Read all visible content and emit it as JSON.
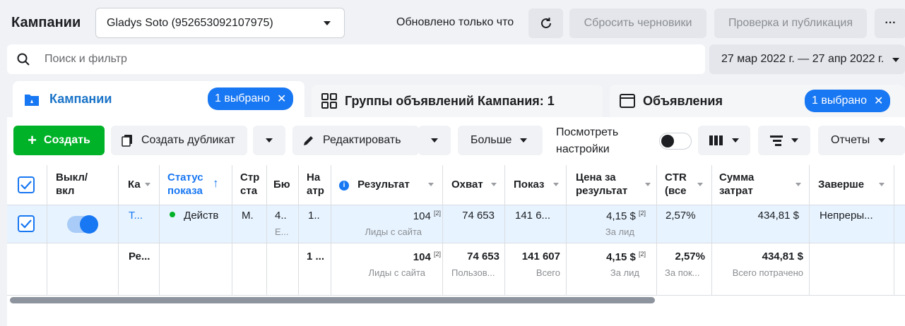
{
  "header": {
    "title": "Кампании",
    "account": "Gladys Soto (952653092107975)",
    "updated": "Обновлено только что",
    "reset_label": "Сбросить черновики",
    "publish_label": "Проверка и публикация",
    "more_label": "···"
  },
  "search": {
    "placeholder": "Поиск и фильтр",
    "date_range": "27 мар 2022 г. — 27 апр 2022 г."
  },
  "tabs": {
    "campaigns": "Кампании",
    "campaigns_badge": "1 выбрано",
    "adsets": "Группы объявлений Кампания: 1",
    "ads": "Объявления",
    "ads_badge": "1 выбрано"
  },
  "toolbar": {
    "create": "Создать",
    "duplicate": "Создать дубликат",
    "edit": "Редактировать",
    "more": "Больше",
    "view_settings_1": "Посмотреть",
    "view_settings_2": "настройки",
    "reports": "Отчеты"
  },
  "columns": {
    "toggle_1": "Выкл/",
    "toggle_2": "вкл",
    "campaign": "Ка",
    "status_1": "Статус",
    "status_2": "показа",
    "strategy_1": "Стр",
    "strategy_2": "ста",
    "budget": "Бю",
    "attr_1": "На",
    "attr_2": "атр",
    "result": "Результат",
    "reach": "Охват",
    "impressions": "Показ",
    "cost_1": "Цена за",
    "cost_2": "результат",
    "ctr_1": "CTR",
    "ctr_2": "(все",
    "spent_1": "Сумма",
    "spent_2": "затрат",
    "ends": "Заверше"
  },
  "row": {
    "campaign": "Т...",
    "status": "Действ",
    "strategy": "М.",
    "budget": "4..",
    "budget_sub": "Е...",
    "attr": "1..",
    "result": "104",
    "result_sup": "[2]",
    "result_sub": "Лиды с сайта",
    "reach": "74 653",
    "impressions": "141 6...",
    "cost": "4,15 $",
    "cost_sup": "[2]",
    "cost_sub": "За лид",
    "ctr": "2,57%",
    "spent": "434,81 $",
    "ends": "Непреры..."
  },
  "totals": {
    "label": "Ре...",
    "attr": "1 ...",
    "result": "104",
    "result_sup": "[2]",
    "result_sub": "Лиды с сайта",
    "reach": "74 653",
    "reach_sub": "Пользов...",
    "impressions": "141 607",
    "impressions_sub": "Всего",
    "cost": "4,15 $",
    "cost_sup": "[2]",
    "cost_sub": "За лид",
    "ctr": "2,57%",
    "ctr_sub": "За пок...",
    "spent": "434,81 $",
    "spent_sub": "Всего потрачено"
  },
  "colors": {
    "primary": "#1877f2",
    "create": "#00b227",
    "selected_row": "#e7f3ff",
    "active_dot": "#00b227"
  }
}
